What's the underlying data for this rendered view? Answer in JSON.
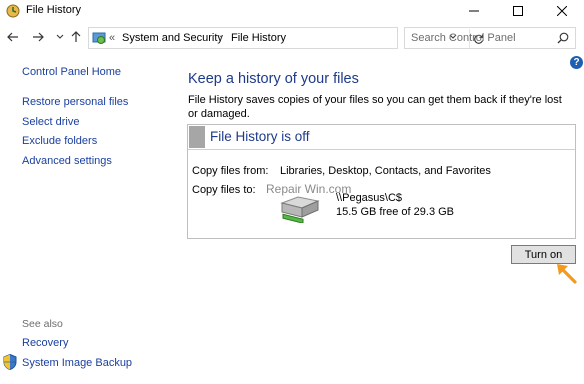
{
  "window": {
    "title": "File History",
    "minimize_icon": "minimize-icon",
    "maximize_icon": "maximize-icon",
    "close_icon": "close-icon"
  },
  "navigation": {
    "prefix": "«",
    "breadcrumbs": [
      "System and Security",
      "File History"
    ],
    "search_placeholder": "Search Control Panel"
  },
  "sidebar": {
    "home": "Control Panel Home",
    "items": [
      "Restore personal files",
      "Select drive",
      "Exclude folders",
      "Advanced settings"
    ],
    "see_also_label": "See also",
    "see_also": [
      "Recovery",
      "System Image Backup"
    ]
  },
  "main": {
    "heading": "Keep a history of your files",
    "description": "File History saves copies of your files so you can get them back if they're lost or damaged.",
    "status_title": "File History is off",
    "copy_from_label": "Copy files from:",
    "copy_from_value": "Libraries, Desktop, Contacts, and Favorites",
    "copy_to_label": "Copy files to:",
    "drive_name": "\\\\Pegasus\\C$",
    "drive_space": "15.5 GB free of 29.3 GB",
    "watermark": "Repair Win.com",
    "turn_on_label": "Turn on"
  },
  "colors": {
    "link": "#1a3f9f",
    "heading": "#1e3a8a",
    "arrow": "#f39a1e"
  }
}
